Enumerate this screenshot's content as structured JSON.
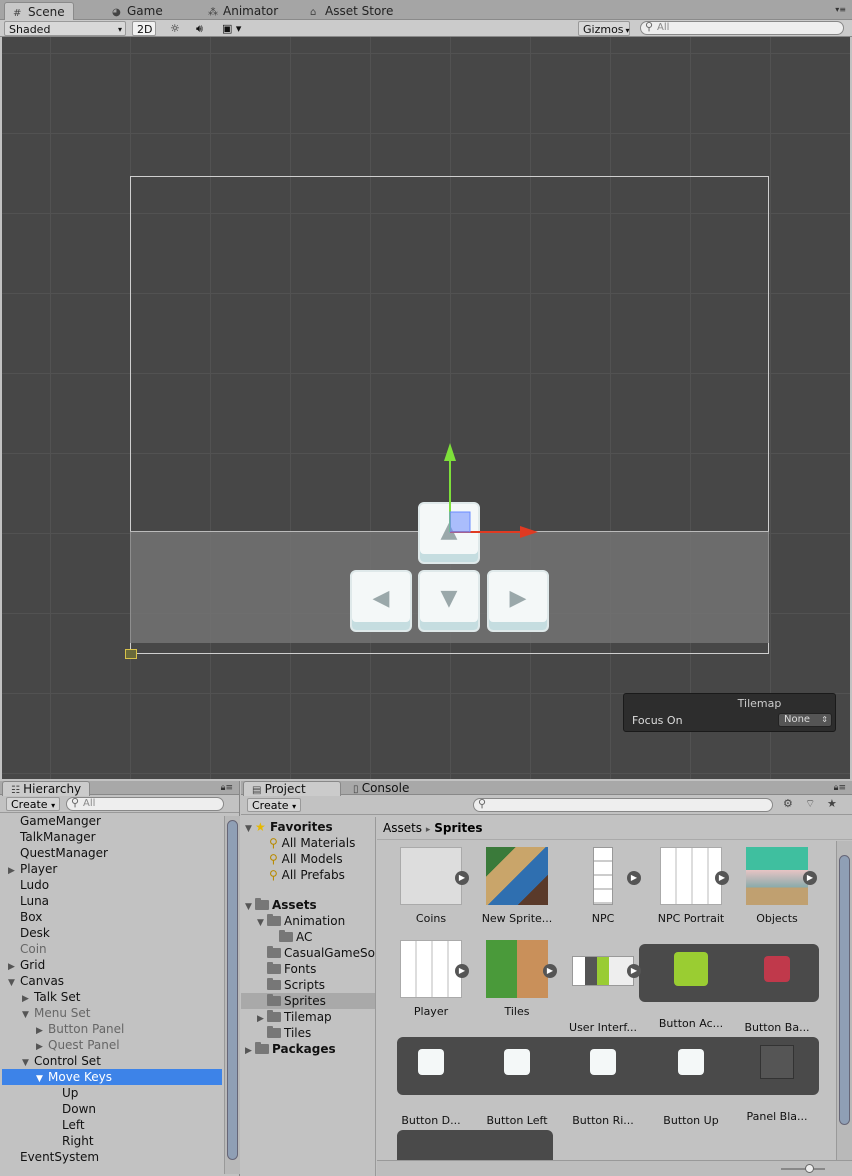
{
  "top_tabs": [
    {
      "label": "Scene",
      "icon": "grid-icon"
    },
    {
      "label": "Game",
      "icon": "pacman-icon"
    },
    {
      "label": "Animator",
      "icon": "animator-icon"
    },
    {
      "label": "Asset Store",
      "icon": "store-icon"
    }
  ],
  "scene_toolbar": {
    "shading_mode": "Shaded",
    "mode_2d": "2D",
    "gizmos": "Gizmos",
    "search_placeholder": "All"
  },
  "tilemap_overlay": {
    "title": "Tilemap",
    "focus_label": "Focus On",
    "focus_value": "None"
  },
  "hierarchy": {
    "tab": "Hierarchy",
    "create": "Create",
    "search_placeholder": "All",
    "items": [
      {
        "label": "GameManger",
        "depth": 0,
        "arrow": "",
        "dim": false
      },
      {
        "label": "TalkManager",
        "depth": 0,
        "arrow": "",
        "dim": false
      },
      {
        "label": "QuestManager",
        "depth": 0,
        "arrow": "",
        "dim": false
      },
      {
        "label": "Player",
        "depth": 0,
        "arrow": "▶",
        "dim": false
      },
      {
        "label": "Ludo",
        "depth": 0,
        "arrow": "",
        "dim": false
      },
      {
        "label": "Luna",
        "depth": 0,
        "arrow": "",
        "dim": false
      },
      {
        "label": "Box",
        "depth": 0,
        "arrow": "",
        "dim": false
      },
      {
        "label": "Desk",
        "depth": 0,
        "arrow": "",
        "dim": false
      },
      {
        "label": "Coin",
        "depth": 0,
        "arrow": "",
        "dim": true
      },
      {
        "label": "Grid",
        "depth": 0,
        "arrow": "▶",
        "dim": false
      },
      {
        "label": "Canvas",
        "depth": 0,
        "arrow": "▼",
        "dim": false
      },
      {
        "label": "Talk Set",
        "depth": 1,
        "arrow": "▶",
        "dim": false
      },
      {
        "label": "Menu Set",
        "depth": 1,
        "arrow": "▼",
        "dim": true
      },
      {
        "label": "Button Panel",
        "depth": 2,
        "arrow": "▶",
        "dim": true
      },
      {
        "label": "Quest Panel",
        "depth": 2,
        "arrow": "▶",
        "dim": true
      },
      {
        "label": "Control Set",
        "depth": 1,
        "arrow": "▼",
        "dim": false
      },
      {
        "label": "Move Keys",
        "depth": 2,
        "arrow": "▼",
        "dim": false,
        "selected": true
      },
      {
        "label": "Up",
        "depth": 3,
        "arrow": "",
        "dim": false
      },
      {
        "label": "Down",
        "depth": 3,
        "arrow": "",
        "dim": false
      },
      {
        "label": "Left",
        "depth": 3,
        "arrow": "",
        "dim": false
      },
      {
        "label": "Right",
        "depth": 3,
        "arrow": "",
        "dim": false
      },
      {
        "label": "EventSystem",
        "depth": 0,
        "arrow": "",
        "dim": false
      }
    ]
  },
  "project": {
    "tab": "Project",
    "console_tab": "Console",
    "create": "Create",
    "favorites": {
      "label": "Favorites",
      "items": [
        "All Materials",
        "All Models",
        "All Prefabs"
      ]
    },
    "assets_tree": [
      {
        "label": "Assets",
        "depth": 0,
        "arrow": "▼",
        "bold": true
      },
      {
        "label": "Animation",
        "depth": 1,
        "arrow": "▼"
      },
      {
        "label": "AC",
        "depth": 2,
        "arrow": ""
      },
      {
        "label": "CasualGameSo",
        "depth": 1,
        "arrow": ""
      },
      {
        "label": "Fonts",
        "depth": 1,
        "arrow": ""
      },
      {
        "label": "Scripts",
        "depth": 1,
        "arrow": ""
      },
      {
        "label": "Sprites",
        "depth": 1,
        "arrow": "",
        "selected": true
      },
      {
        "label": "Tilemap",
        "depth": 1,
        "arrow": "▶"
      },
      {
        "label": "Tiles",
        "depth": 1,
        "arrow": ""
      },
      {
        "label": "Packages",
        "depth": 0,
        "arrow": "▶",
        "bold": true
      }
    ],
    "breadcrumb": {
      "root": "Assets",
      "separator": "▸",
      "current": "Sprites"
    },
    "assets": [
      {
        "label": "Coins"
      },
      {
        "label": "New Sprite..."
      },
      {
        "label": "NPC"
      },
      {
        "label": "NPC Portrait"
      },
      {
        "label": "Objects"
      },
      {
        "label": "Player"
      },
      {
        "label": "Tiles"
      },
      {
        "label": "User Interf..."
      },
      {
        "label": "Button Ac..."
      },
      {
        "label": "Button Ba..."
      },
      {
        "label": "Button D..."
      },
      {
        "label": "Button Left"
      },
      {
        "label": "Button Ri..."
      },
      {
        "label": "Button Up"
      },
      {
        "label": "Panel Bla..."
      }
    ]
  },
  "colors": {
    "selection": "#3d83e8",
    "scene_bg": "#474747",
    "gizmo_green": "#7ee03a",
    "gizmo_red": "#e03a22"
  }
}
